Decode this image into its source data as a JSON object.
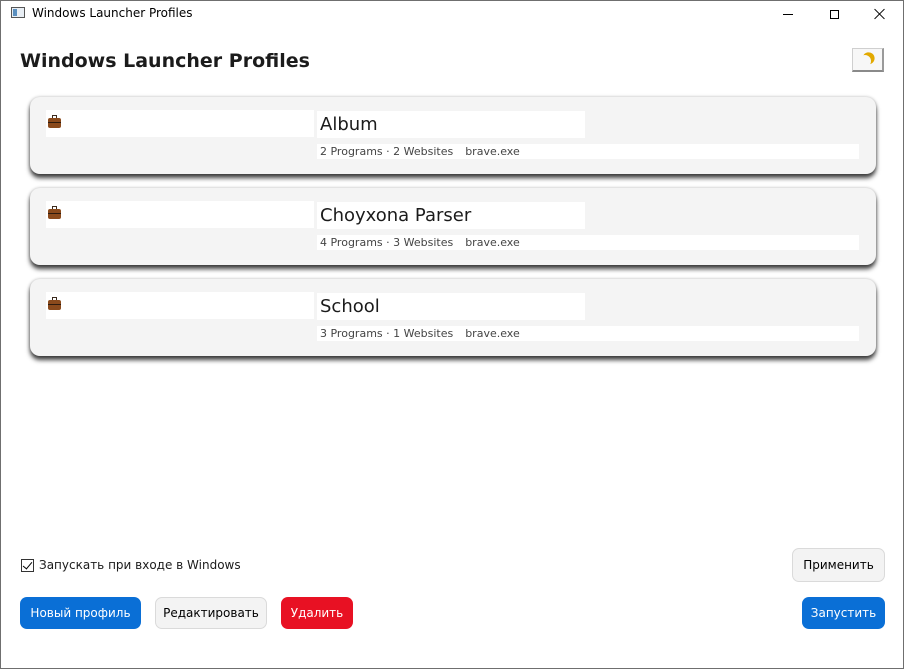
{
  "window": {
    "title": "Windows Launcher Profiles"
  },
  "header": {
    "title": "Windows Launcher Profiles",
    "theme_toggle_icon": "moon-icon"
  },
  "profiles": [
    {
      "icon": "briefcase-icon",
      "name": "Album",
      "summary": "2 Programs · 2 Websites",
      "browser": "brave.exe"
    },
    {
      "icon": "briefcase-icon",
      "name": "Choyxona Parser",
      "summary": "4 Programs · 3 Websites",
      "browser": "brave.exe"
    },
    {
      "icon": "briefcase-icon",
      "name": "School",
      "summary": "3 Programs · 1 Websites",
      "browser": "brave.exe"
    }
  ],
  "settings": {
    "autostart_label": "Запускать при входе в Windows",
    "autostart_checked": true,
    "apply_label": "Применить"
  },
  "actions": {
    "new_label": "Новый профиль",
    "edit_label": "Редактировать",
    "delete_label": "Удалить",
    "launch_label": "Запустить"
  },
  "colors": {
    "primary": "#0a6fd6",
    "danger": "#e81123",
    "card_bg": "#f4f4f4"
  }
}
